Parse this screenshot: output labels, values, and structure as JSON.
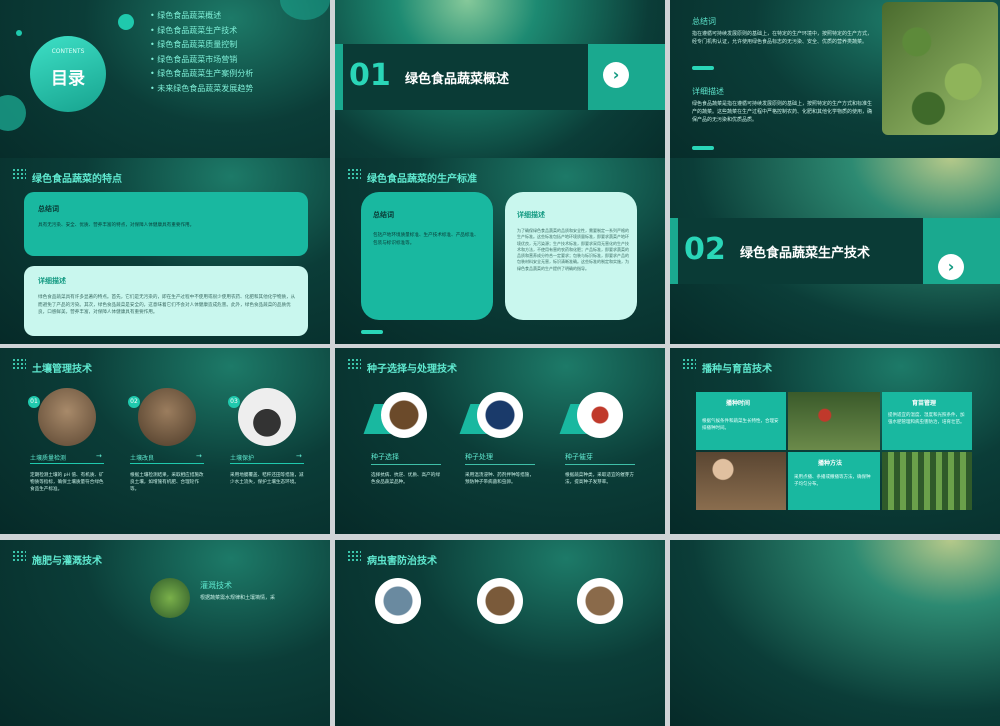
{
  "slides": {
    "toc": {
      "subtitle": "CONTENTS",
      "title": "目录",
      "items": [
        "绿色食品蔬菜概述",
        "绿色食品蔬菜生产技术",
        "绿色食品蔬菜质量控制",
        "绿色食品蔬菜市场营销",
        "绿色食品蔬菜生产案例分析",
        "未来绿色食品蔬菜发展趋势"
      ]
    },
    "section1": {
      "number": "01",
      "name": "绿色食品蔬菜概述"
    },
    "overview": {
      "summary_label": "总结词",
      "summary_text": "指在遵循可持续发展原则的基础上，在特定的生产环境中，按照特定的生产方式，经专门机构认证，允许使用绿色食品标志的无污染、安全、优质的营养类蔬菜。",
      "detail_label": "详细描述",
      "detail_text": "绿色食品蔬菜是指在遵循可持续发展原则的基础上，按照特定的生产方式和标准生产的蔬菜。这些蔬菜在生产过程中严格控制农药、化肥和其他化学物质的使用，确保产品的无污染和优质品质。"
    },
    "features": {
      "title": "绿色食品蔬菜的特点",
      "summary_label": "总结词",
      "summary_text": "具有无污染、安全、优质、营养丰富的特点，对保障人体健康具有重要作用。",
      "detail_label": "详细描述",
      "detail_text": "绿色食品蔬菜具有许多显著的特点。首先，它们是无污染的，即在生产过程中不使用或很少使用农药、化肥和其他化学物质，从而避免了产品的污染。其次，绿色食品蔬菜是安全的，这意味着它们不会对人体健康造成危害。此外，绿色食品蔬菜的品质优良，口感鲜美，营养丰富，对保障人体健康具有重要作用。"
    },
    "standards": {
      "title": "绿色食品蔬菜的生产标准",
      "summary_label": "总结词",
      "summary_text": "包括产地环境质量标准、生产技术标准、产品标准、包装与标识标准等。",
      "detail_label": "详细描述",
      "detail_text": "为了确保绿色食品蔬菜的品质和安全性，需要制定一系列严格的生产标准。这些标准包括产地环境质量标准，即要求蔬菜产地环境优良，无污染源；生产技术标准，即要求采用无害化的生产技术和方法，不使用有害的农药和化肥；产品标准，即要求蔬菜的品质和营养成分符合一定要求；包装与标识标准，即要求产品的包装材料安全无害，标识清晰准确。这些标准的制定和实施，为绿色食品蔬菜的生产提供了明确的指导。"
    },
    "section2": {
      "number": "02",
      "name": "绿色食品蔬菜生产技术"
    },
    "soil": {
      "title": "土壤管理技术",
      "items": [
        {
          "num": "01",
          "label": "土壤质量检测",
          "text": "定期检测土壤的 pH 值、有机质、矿物质等指标，确保土壤质量符合绿色食品生产标准。"
        },
        {
          "num": "02",
          "label": "土壤改良",
          "text": "根据土壤检测结果，采取相应措施改良土壤，如增施有机肥、合理轮作等。"
        },
        {
          "num": "03",
          "label": "土壤保护",
          "text": "采用地膜覆盖、秸秆还田等措施，减少水土流失，保护土壤生态环境。"
        }
      ]
    },
    "seed": {
      "title": "种子选择与处理技术",
      "items": [
        {
          "label": "种子选择",
          "text": "选择抗病、抗逆、优质、高产的绿色食品蔬菜品种。"
        },
        {
          "label": "种子处理",
          "text": "采用温汤浸种、药剂拌种等措施，预防种子带病菌和虫卵。"
        },
        {
          "label": "种子催芽",
          "text": "根据蔬菜种类，采取适宜的催芽方法，提高种子发芽率。"
        }
      ]
    },
    "sowing": {
      "title": "播种与育苗技术",
      "time_label": "播种时间",
      "time_text": "根据气候条件和蔬菜生长特性，合理安排播种时间。",
      "seedling_label": "育苗管理",
      "seedling_text": "提供适宜的温度、湿度和光照条件，加强水肥管理和病虫害防治，培育壮苗。",
      "method_label": "播种方法",
      "method_text": "采用点播、条播或撒播等方法，确保种子均匀分布。"
    },
    "fertilize": {
      "title": "施肥与灌溉技术",
      "label": "灌溉技术",
      "text": "根据蔬菜需水规律和土壤墒情，采"
    },
    "pest": {
      "title": "病虫害防治技术"
    }
  },
  "colors": {
    "accent": "#1fc9ad",
    "dark": "#062a28",
    "light_card": "#c9f7ee"
  }
}
